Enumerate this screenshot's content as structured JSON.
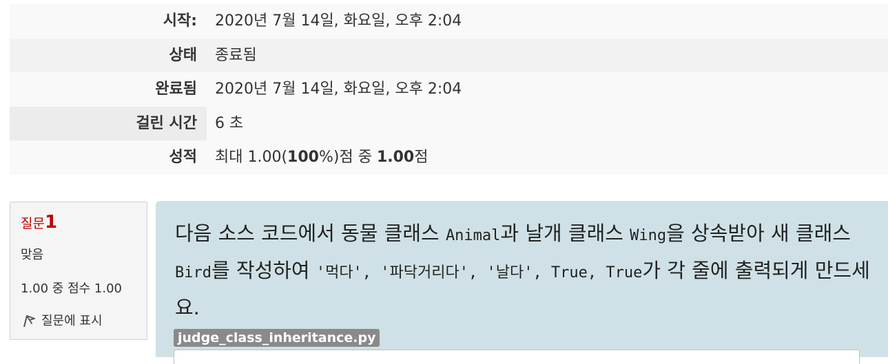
{
  "summary": {
    "started_label": "시작:",
    "started_value": "2020년 7월 14일, 화요일, 오후 2:04",
    "state_label": "상태",
    "state_value": "종료됨",
    "completed_label": "완료됨",
    "completed_value": "2020년 7월 14일, 화요일, 오후 2:04",
    "time_label": "걸린 시간",
    "time_value": "6 초",
    "grade_label": "성적",
    "grade_prefix": "최대 1.00(",
    "grade_percent": "100",
    "grade_mid": "%)점 중 ",
    "grade_score": "1.00",
    "grade_suffix": "점"
  },
  "question": {
    "label": "질문",
    "number": "1",
    "state": "맞음",
    "grade": "1.00 중 점수 1.00",
    "flag_label": "질문에 표시",
    "text_1": "다음 소스 코드에서 동물 클래스 ",
    "code_animal": "Animal",
    "text_2": "과 날개 클래스 ",
    "code_wing": "Wing",
    "text_3": "을 상속받아 새 클래스 ",
    "code_bird": "Bird",
    "text_4": "를 작성하여 ",
    "code_outputs": "'먹다', '파닥거리다', '날다', True, True",
    "text_5": "가 각 줄에 출력되게 만드세요.",
    "filename": "judge_class_inheritance.py"
  },
  "icons": {
    "flag": "flag-icon"
  }
}
